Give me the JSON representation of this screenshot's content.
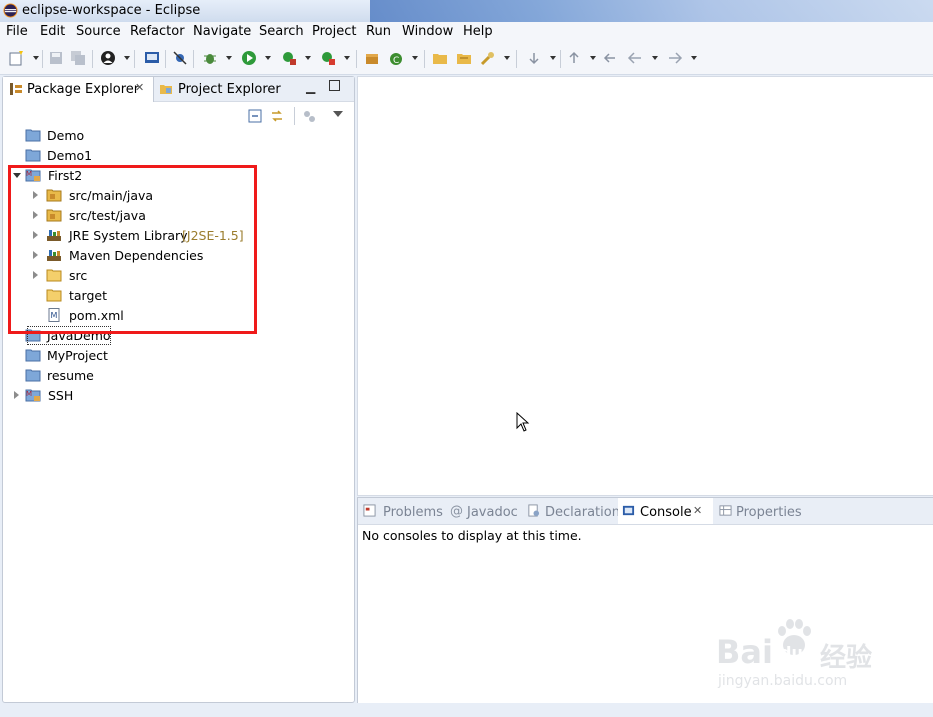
{
  "window": {
    "title": "eclipse-workspace - Eclipse"
  },
  "menu": [
    "File",
    "Edit",
    "Source",
    "Refactor",
    "Navigate",
    "Search",
    "Project",
    "Run",
    "Window",
    "Help"
  ],
  "left_view": {
    "tabs": [
      {
        "label": "Package Explorer",
        "close": "✕",
        "active": true
      },
      {
        "label": "Project Explorer",
        "active": false
      }
    ],
    "tree": [
      {
        "label": "Demo",
        "type": "project",
        "twisty": "none"
      },
      {
        "label": "Demo1",
        "type": "project",
        "twisty": "none"
      },
      {
        "label": "First2",
        "type": "maven-project",
        "twisty": "open"
      },
      {
        "label": "src/main/java",
        "type": "source-folder",
        "twisty": "closed"
      },
      {
        "label": "src/test/java",
        "type": "source-folder",
        "twisty": "closed"
      },
      {
        "label": "JRE System Library",
        "decoration": "[J2SE-1.5]",
        "type": "library",
        "twisty": "closed"
      },
      {
        "label": "Maven Dependencies",
        "type": "library",
        "twisty": "closed"
      },
      {
        "label": "src",
        "type": "folder",
        "twisty": "closed"
      },
      {
        "label": "target",
        "type": "folder",
        "twisty": "none"
      },
      {
        "label": "pom.xml",
        "type": "maven-file",
        "twisty": "none"
      },
      {
        "label": "JavaDemo",
        "type": "project",
        "twisty": "none"
      },
      {
        "label": "MyProject",
        "type": "project",
        "twisty": "none"
      },
      {
        "label": "resume",
        "type": "project",
        "twisty": "none"
      },
      {
        "label": "SSH",
        "type": "maven-project",
        "twisty": "closed"
      }
    ]
  },
  "console_view": {
    "tabs": [
      {
        "label": "Problems",
        "icon": "problems-icon"
      },
      {
        "label": "Javadoc",
        "icon": "at-icon"
      },
      {
        "label": "Declaration",
        "icon": "declaration-icon"
      },
      {
        "label": "Console",
        "icon": "console-icon",
        "active": true,
        "close": "✕"
      },
      {
        "label": "Properties",
        "icon": "properties-icon"
      }
    ],
    "message": "No consoles to display at this time."
  },
  "watermark": {
    "brand": "Bai",
    "brand2": "du",
    "cn": "经验",
    "url": "jingyan.baidu.com"
  },
  "colors": {
    "highlight": "#ef1a1a",
    "accent": "#2b6cb0",
    "decoration": "#9b7d2e"
  }
}
